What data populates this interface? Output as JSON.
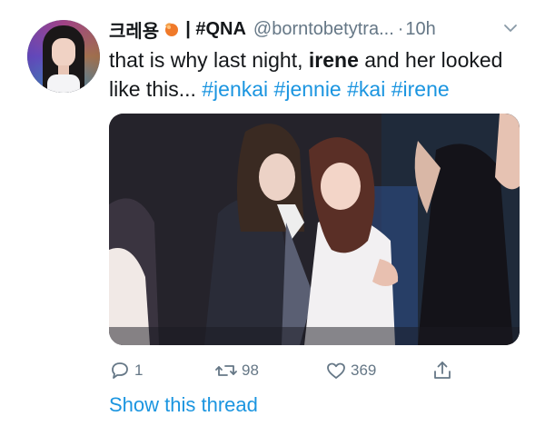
{
  "tweet": {
    "display_name": "크레용",
    "name_suffix": "| #QNA",
    "handle": "@borntobetytra...",
    "dot": "·",
    "time": "10h",
    "text": {
      "part1": "that is why last night, ",
      "bold": "irene",
      "part2": " and her looked like this... ",
      "hashtags": [
        "#jenkai",
        "#jennie",
        "#kai",
        "#irene"
      ]
    }
  },
  "actions": {
    "replies": "1",
    "retweets": "98",
    "likes": "369"
  },
  "thread_link": "Show this thread",
  "icons": {
    "emoji": "orange-fire-emoji-icon",
    "more": "chevron-down-icon",
    "reply": "reply-icon",
    "retweet": "retweet-icon",
    "like": "heart-icon",
    "share": "share-icon"
  },
  "colors": {
    "link": "#1b95e0",
    "secondary": "#657786",
    "text": "#14171a"
  }
}
